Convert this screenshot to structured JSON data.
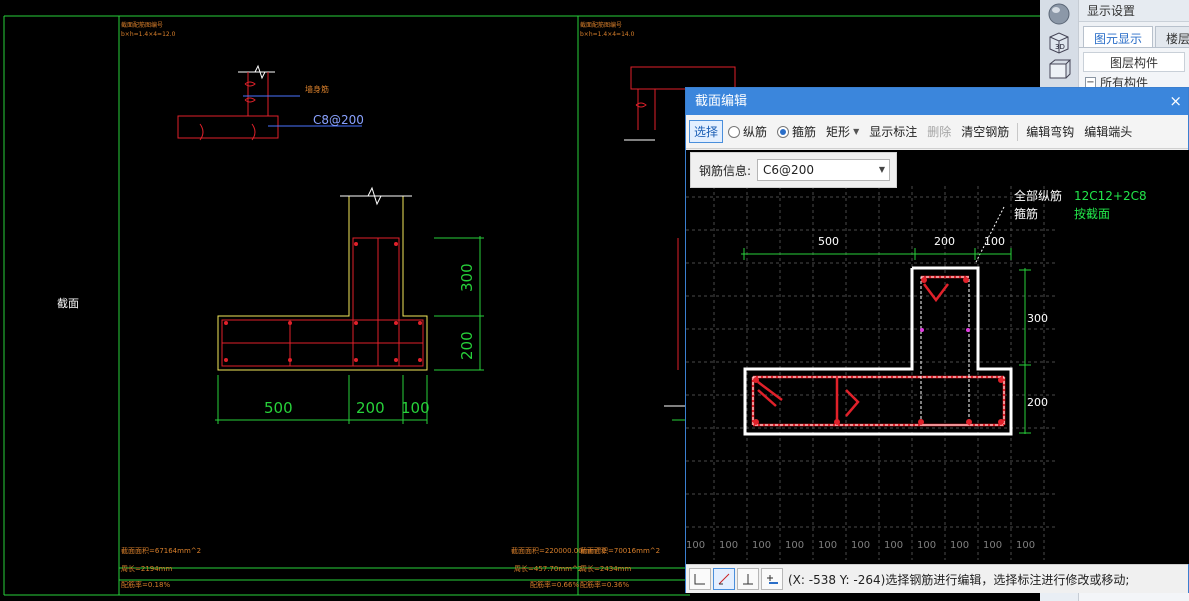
{
  "left_drawing": {
    "section_label": "截面",
    "title_block_left": [
      "截面配筋图编号",
      "b×h=1.4×4=12.0"
    ],
    "title_block_right": [
      "截面配筋图编号",
      "b×h=1.4×4=14.0"
    ],
    "callout_label": "墙身筋",
    "stirrup_label": "C8@200",
    "dims_horizontal": [
      "500",
      "200",
      "100"
    ],
    "dims_vertical": [
      "300",
      "200"
    ],
    "footer_left": [
      "截面面积=67164mm^2",
      "周长=2194mm",
      "配筋率=0.18%"
    ],
    "footer_right_a": [
      "截面面积=220000.00mm^2",
      "周长=457.70mm^2",
      "配筋率=0.66%"
    ],
    "footer_right_b": [
      "截面面积=70016mm^2",
      "周长=2434mm",
      "配筋率=0.36%"
    ]
  },
  "right_panel": {
    "title": "显示设置",
    "tabs": [
      {
        "label": "图元显示",
        "active": true
      },
      {
        "label": "楼层",
        "active": false
      }
    ],
    "header": "图层构件",
    "tree_item": "所有构件",
    "tools": [
      "sphere-icon",
      "3d-cube-icon",
      "box-icon"
    ]
  },
  "dialog": {
    "title": "截面编辑",
    "close": "×",
    "toolbar": {
      "select": "选择",
      "longitudinal": "纵筋",
      "stirrup": "箍筋",
      "shape": "矩形",
      "show_annotation": "显示标注",
      "delete": "删除",
      "clear_rebar": "清空钢筋",
      "edit_hook": "编辑弯钩",
      "edit_end": "编辑端头"
    },
    "rebar_info_label": "钢筋信息:",
    "rebar_info_value": "C6@200",
    "canvas": {
      "legend": [
        {
          "label": "全部纵筋",
          "value": "12C12+2C8",
          "color": "#22e54a"
        },
        {
          "label": "箍筋",
          "value": "按截面",
          "color": "#22e54a"
        }
      ],
      "dims_top": [
        "500",
        "200",
        "100"
      ],
      "dims_right": [
        "300",
        "200"
      ],
      "grid_labels": [
        "100",
        "100",
        "100",
        "100",
        "100",
        "100",
        "100",
        "100",
        "100",
        "100",
        "100"
      ]
    },
    "status": "(X: -538 Y: -264)选择钢筋进行编辑，选择标注进行修改或移动;"
  },
  "colors": {
    "frame": "#27d13a",
    "rebar": "#e0212a",
    "outline": "#ffffff",
    "section_outline": "#f5e85a",
    "dimension": "#27d13a",
    "accent": "#3b86dc"
  }
}
